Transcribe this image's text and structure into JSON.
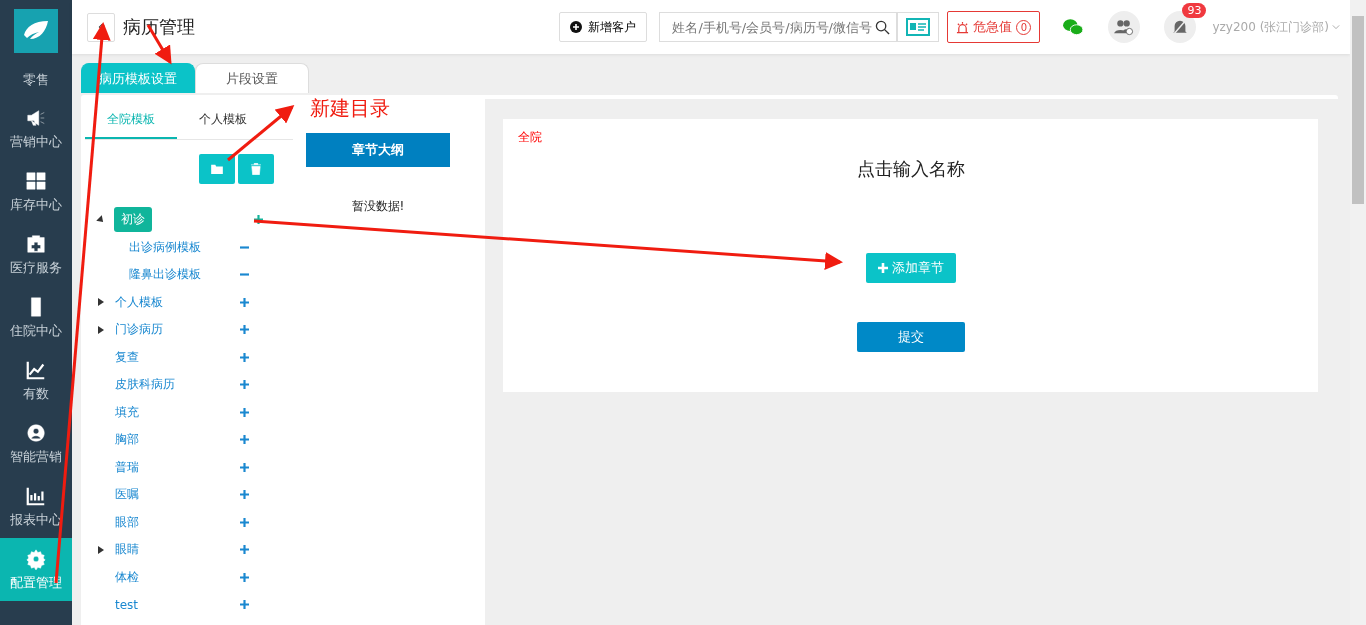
{
  "sidebar": {
    "items": [
      {
        "label": "零售",
        "selected": false
      },
      {
        "label": "营销中心",
        "selected": false
      },
      {
        "label": "库存中心",
        "selected": false
      },
      {
        "label": "医疗服务",
        "selected": false
      },
      {
        "label": "住院中心",
        "selected": false
      },
      {
        "label": "有数",
        "selected": false
      },
      {
        "label": "智能营销",
        "selected": false
      },
      {
        "label": "报表中心",
        "selected": false
      },
      {
        "label": "配置管理",
        "selected": true
      }
    ]
  },
  "header": {
    "title": "病历管理",
    "new_customer": "新增客户",
    "search": {
      "placeholder": "姓名/手机号/会员号/病历号/微信号"
    },
    "critical": {
      "label": "危急值",
      "count": "0"
    },
    "notifications": "93",
    "user": "yzy200 (张江门诊部)"
  },
  "tabs": [
    {
      "label": "病历模板设置",
      "selected": true
    },
    {
      "label": "片段设置",
      "selected": false
    }
  ],
  "subtabs": [
    {
      "label": "全院模板",
      "selected": true
    },
    {
      "label": "个人模板",
      "selected": false
    }
  ],
  "tree": [
    {
      "label": "初诊",
      "selected": true,
      "expanded": true,
      "kind": "add",
      "children": [
        {
          "label": "出诊病例模板",
          "selected": false,
          "kind": "remove"
        },
        {
          "label": "隆鼻出诊模板",
          "selected": false,
          "kind": "remove"
        }
      ]
    },
    {
      "label": "个人模板",
      "selected": false,
      "expanded": false,
      "kind": "add"
    },
    {
      "label": "门诊病历",
      "selected": false,
      "expanded": false,
      "kind": "add"
    },
    {
      "label": "复查",
      "selected": false,
      "kind": "add"
    },
    {
      "label": "皮肤科病历",
      "selected": false,
      "kind": "add"
    },
    {
      "label": "填充",
      "selected": false,
      "kind": "add"
    },
    {
      "label": "胸部",
      "selected": false,
      "kind": "add"
    },
    {
      "label": "普瑞",
      "selected": false,
      "kind": "add"
    },
    {
      "label": "医嘱",
      "selected": false,
      "kind": "add"
    },
    {
      "label": "眼部",
      "selected": false,
      "kind": "add"
    },
    {
      "label": "眼睛",
      "selected": false,
      "expanded": false,
      "kind": "add"
    },
    {
      "label": "体检",
      "selected": false,
      "kind": "add"
    },
    {
      "label": "test",
      "selected": false,
      "kind": "add"
    }
  ],
  "outline": {
    "header": "章节大纲",
    "empty": "暂没数据!"
  },
  "editor": {
    "scope": "全院",
    "name_placeholder": "点击输入名称",
    "add_section": "添加章节",
    "submit": "提交"
  },
  "annotation": {
    "label": "新建目录"
  }
}
